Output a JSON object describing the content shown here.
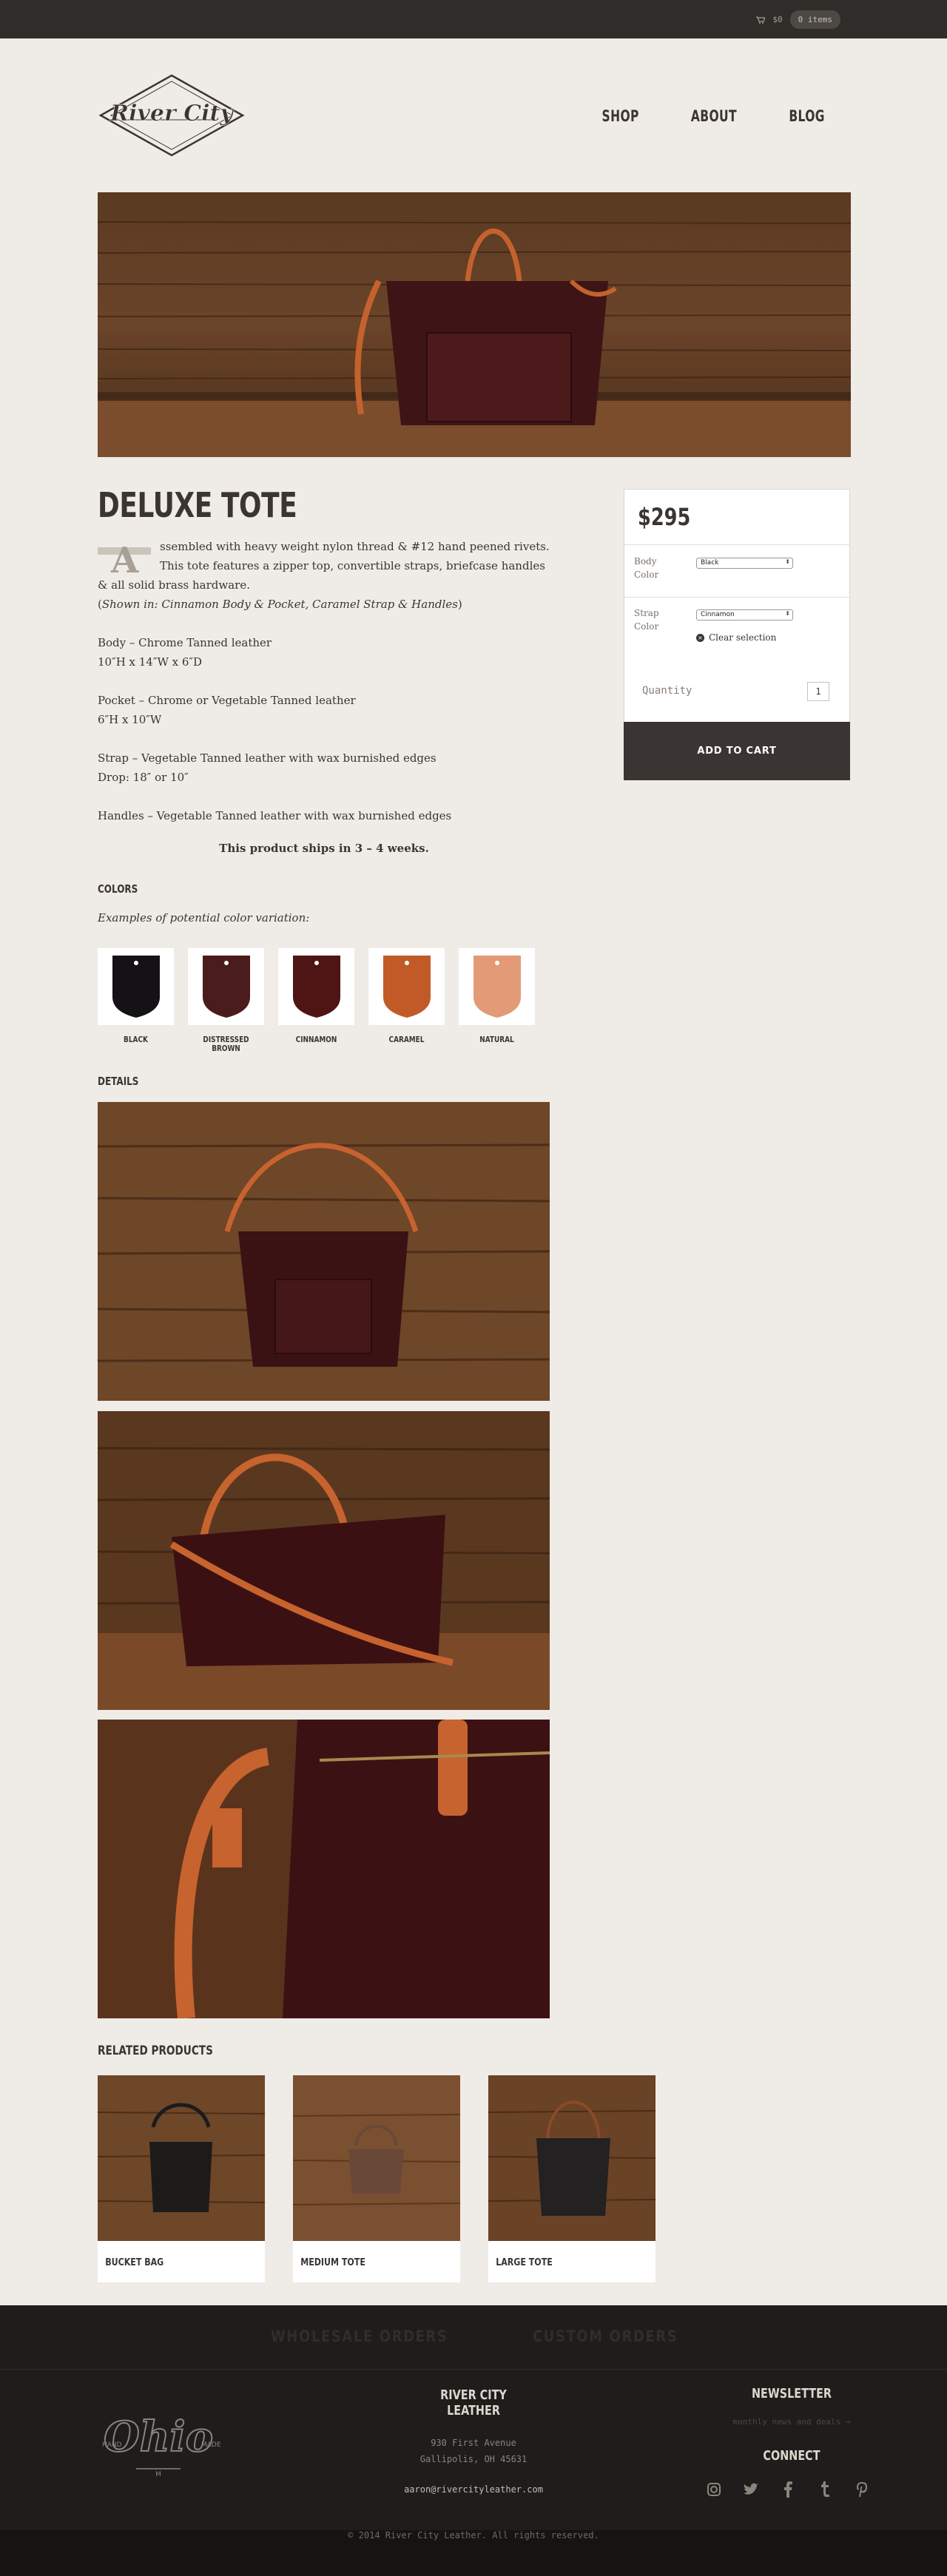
{
  "header": {
    "cart_total": "$0",
    "cart_items": "0 items",
    "logo_text": "River City",
    "nav": [
      "SHOP",
      "ABOUT",
      "BLOG"
    ]
  },
  "product": {
    "title": "DELUXE TOTE",
    "dropcap": "A",
    "intro": "ssembled with heavy weight nylon thread & #12 hand peened rivets. This tote features a zipper top, convertible straps, briefcase handles & all solid brass hardware.",
    "shown_prefix": "(",
    "shown_label": "Shown in: Cinnamon Body & Pocket, Caramel Strap & Handles",
    "shown_suffix": ")",
    "body_line1": "Body – Chrome Tanned leather",
    "body_line2": "10″H x 14″W x 6″D",
    "pocket_line1": "Pocket – Chrome or Vegetable Tanned leather",
    "pocket_line2": "6″H x 10″W",
    "strap_line1": "Strap – Vegetable Tanned leather with wax burnished edges",
    "strap_line2": "Drop: 18″ or 10″",
    "handles_line": "Handles – Vegetable Tanned leather with wax burnished edges",
    "ships": "This product ships in  3 – 4 weeks."
  },
  "colors": {
    "title": "COLORS",
    "subtitle": "Examples of potential color variation:",
    "swatches": [
      {
        "label": "BLACK",
        "color": "#141215"
      },
      {
        "label": "DISTRESSED BROWN",
        "color": "#4a1c1b"
      },
      {
        "label": "CINNAMON",
        "color": "#4f1414"
      },
      {
        "label": "CARAMEL",
        "color": "#c25a28"
      },
      {
        "label": "NATURAL",
        "color": "#e29a77"
      }
    ]
  },
  "details": {
    "title": "DETAILS"
  },
  "purchase": {
    "price": "$295",
    "body_color_label": "Body Color",
    "body_color_value": "Black",
    "strap_color_label": "Strap Color",
    "strap_color_value": "Cinnamon",
    "clear_label": "Clear selection",
    "quantity_label": "Quantity",
    "quantity_value": "1",
    "add_to_cart": "ADD TO CART"
  },
  "related": {
    "title": "RELATED PRODUCTS",
    "items": [
      {
        "label": "BUCKET BAG",
        "color": "#1d1b1a"
      },
      {
        "label": "MEDIUM TOTE",
        "color": "#6a4838"
      },
      {
        "label": "LARGE TOTE",
        "color": "#232121"
      }
    ]
  },
  "footer": {
    "wholesale": "WHOLESALE ORDERS",
    "custom": "CUSTOM ORDERS",
    "logo_text": "Ohio",
    "logo_left": "HAND",
    "logo_right": "MADE",
    "company_title": "RIVER CITY LEATHER",
    "address1": "930 First Avenue",
    "address2": "Gallipolis, OH 45631",
    "email": "aaron@rivercityleather.com",
    "newsletter_title": "NEWSLETTER",
    "newsletter_sub": "monthly news and deals →",
    "connect_title": "CONNECT",
    "copyright": "© 2014 River City Leather. All rights reserved."
  }
}
